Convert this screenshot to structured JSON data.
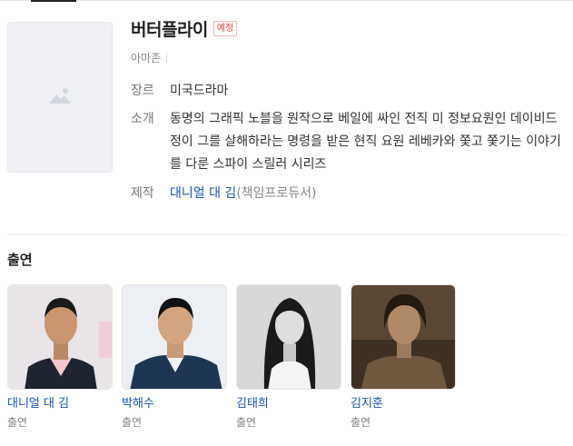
{
  "show": {
    "title": "버터플라이",
    "status_badge": "예정",
    "network": "아마존"
  },
  "info": {
    "genre_label": "장르",
    "genre_value": "미국드라마",
    "plot_label": "소개",
    "plot_value": "동명의 그래픽 노블을 원작으로 베일에 싸인 전직 미 정보요원인 데이비드 정이 그를 살해하라는 명령을 받은 현직 요원 레베카와 쫓고 쫓기는 이야기를 다룬 스파이 스릴러 시리즈",
    "producer_label": "제작",
    "producer_name": "대니얼 대 김",
    "producer_role": "(책임프로듀서)"
  },
  "cast_section": {
    "title": "출연",
    "members": [
      {
        "name": "대니얼 대 김",
        "role": "출연"
      },
      {
        "name": "박해수",
        "role": "출연"
      },
      {
        "name": "김태희",
        "role": "출연"
      },
      {
        "name": "김지훈",
        "role": "출연"
      }
    ]
  },
  "colors": {
    "link": "#1a55b8",
    "badge": "#e54646",
    "poster_bg": "#eef0f4"
  },
  "icons": {
    "poster_placeholder": "image-placeholder-icon"
  }
}
